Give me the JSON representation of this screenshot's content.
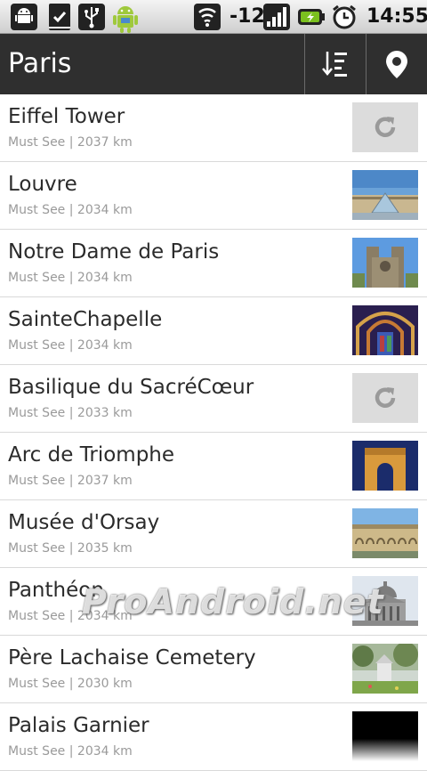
{
  "statusbar": {
    "signal_text": "-12",
    "time": "14:55",
    "icons": [
      "android-debug-icon",
      "download-complete-icon",
      "usb-icon",
      "android-robot-icon",
      "wifi-icon",
      "signal-icon",
      "battery-charging-icon",
      "alarm-icon"
    ]
  },
  "actionbar": {
    "title": "Paris",
    "sort_icon": "sort-icon",
    "location_icon": "map-pin-icon"
  },
  "items": [
    {
      "name": "Eiffel Tower",
      "meta": "Must See | 2037 km",
      "thumb": "loading"
    },
    {
      "name": "Louvre",
      "meta": "Must See | 2034 km",
      "thumb": "louvre"
    },
    {
      "name": "Notre Dame de Paris",
      "meta": "Must See | 2034 km",
      "thumb": "notredame"
    },
    {
      "name": "SainteChapelle",
      "meta": "Must See | 2034 km",
      "thumb": "chapelle"
    },
    {
      "name": "Basilique du SacréCœur",
      "meta": "Must See | 2033 km",
      "thumb": "loading"
    },
    {
      "name": "Arc de Triomphe",
      "meta": "Must See | 2037 km",
      "thumb": "arc"
    },
    {
      "name": "Musée d'Orsay",
      "meta": "Must See | 2035 km",
      "thumb": "orsay"
    },
    {
      "name": "Panthéon",
      "meta": "Must See | 2034 km",
      "thumb": "pantheon"
    },
    {
      "name": "Père Lachaise Cemetery",
      "meta": "Must See | 2030 km",
      "thumb": "cemetery"
    },
    {
      "name": "Palais Garnier",
      "meta": "Must See | 2034 km",
      "thumb": "garnier"
    }
  ],
  "watermark": "ProAndroid.net"
}
